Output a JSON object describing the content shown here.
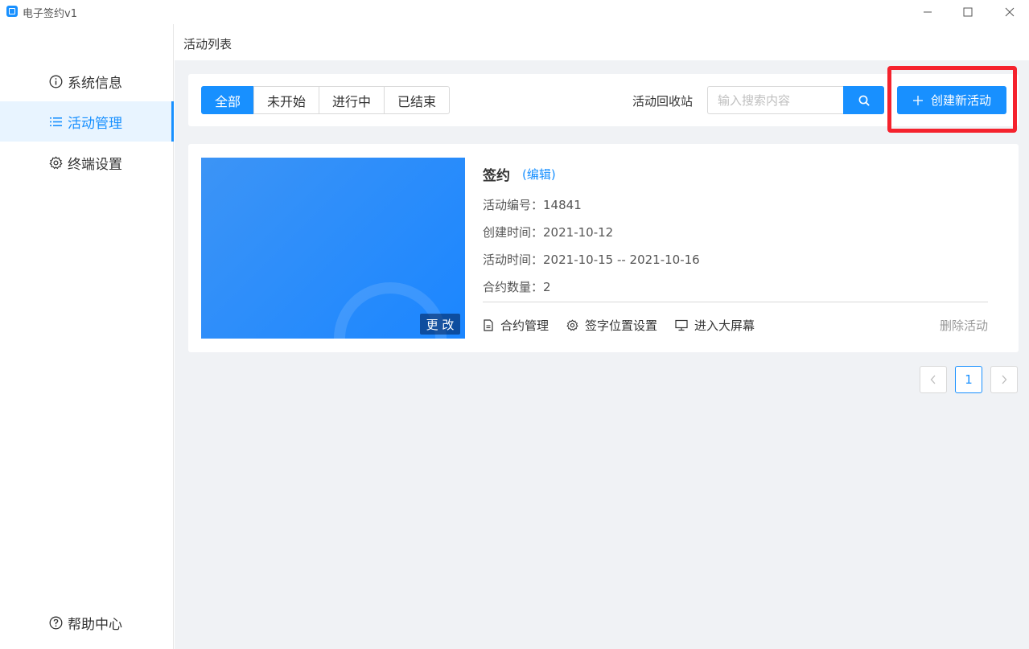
{
  "window": {
    "title": "电子签约v1",
    "controls": {
      "minimize": "—",
      "maximize": "☐",
      "close": "✕"
    }
  },
  "sidebar": {
    "items": [
      {
        "label": "系统信息",
        "icon": "info-circle-icon"
      },
      {
        "label": "活动管理",
        "icon": "list-icon",
        "active": true
      },
      {
        "label": "终端设置",
        "icon": "gear-icon"
      }
    ],
    "help": {
      "label": "帮助中心",
      "icon": "question-circle-icon"
    }
  },
  "breadcrumb": "活动列表",
  "toolbar": {
    "filters": [
      {
        "label": "全部",
        "active": true
      },
      {
        "label": "未开始"
      },
      {
        "label": "进行中"
      },
      {
        "label": "已结束"
      }
    ],
    "recycle_label": "活动回收站",
    "search": {
      "placeholder": "输入搜索内容",
      "value": "",
      "icon": "search-icon"
    },
    "create_button": {
      "label": "创建新活动",
      "icon": "plus-icon"
    }
  },
  "activities": [
    {
      "title": "签约",
      "edit_label": "(编辑)",
      "cover_button": "更 改",
      "meta": [
        {
          "label": "活动编号：",
          "value": "14841"
        },
        {
          "label": "创建时间：",
          "value": "2021-10-12"
        },
        {
          "label": "活动时间：",
          "value": "2021-10-15 -- 2021-10-16"
        },
        {
          "label": "合约数量：",
          "value": "2"
        }
      ],
      "actions": [
        {
          "label": "合约管理",
          "icon": "file-icon"
        },
        {
          "label": "签字位置设置",
          "icon": "gear-icon"
        },
        {
          "label": "进入大屏幕",
          "icon": "monitor-icon"
        }
      ],
      "delete_label": "删除活动"
    }
  ],
  "pagination": {
    "prev": "‹",
    "current_page": "1",
    "next": "›"
  },
  "colors": {
    "primary": "#1890ff",
    "highlight": "#f5222d",
    "background": "#f0f2f5"
  }
}
